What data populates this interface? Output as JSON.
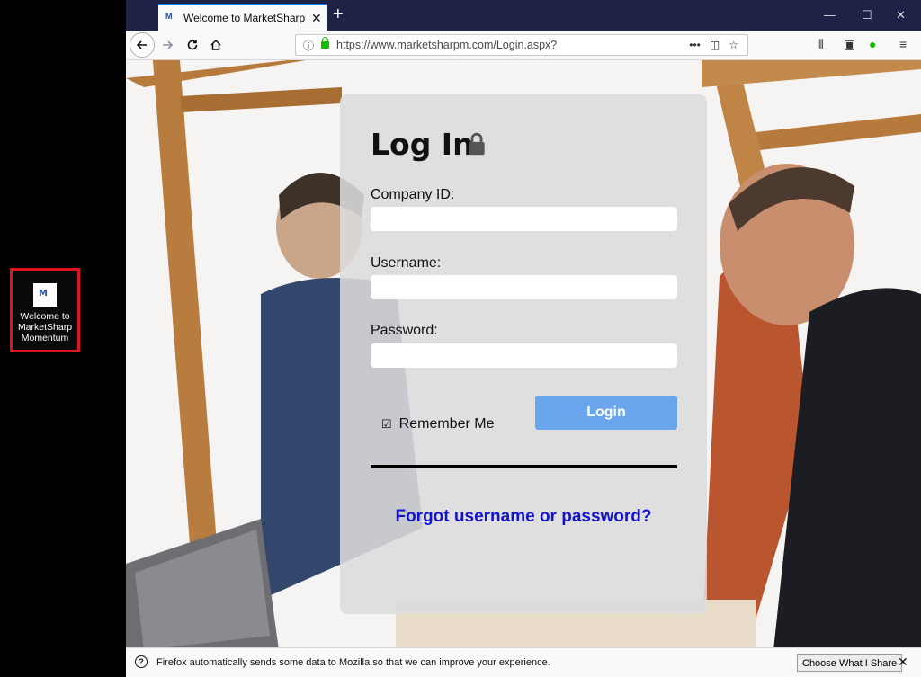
{
  "desktop": {
    "shortcut_label": "Welcome to MarketSharp Momentum"
  },
  "browser": {
    "tab_title": "Welcome to MarketSharp Mom",
    "new_tab": "+",
    "url": "https://www.marketsharpm.com/Login.aspx?",
    "window_controls": [
      "—",
      "☐",
      "✕"
    ]
  },
  "login": {
    "heading": "Log In",
    "company_label": "Company ID:",
    "username_label": "Username:",
    "password_label": "Password:",
    "company_value": "",
    "username_value": "",
    "password_value": "",
    "remember_label": "Remember Me",
    "remember_checked": true,
    "login_button": "Login",
    "forgot_link": "Forgot username or password?"
  },
  "notification": {
    "message": "Firefox automatically sends some data to Mozilla so that we can improve your experience.",
    "button": "Choose What I Share"
  },
  "colors": {
    "accent": "#0a84ff",
    "login_button": "#6aa4ec",
    "link": "#1414d0",
    "titlebar": "#1f2247"
  }
}
